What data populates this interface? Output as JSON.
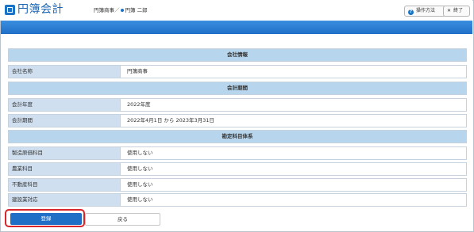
{
  "app": {
    "title": "円簿会計",
    "company": "円簿商事",
    "separator": "／",
    "user": "円簿 二郎"
  },
  "header_buttons": {
    "help_label": "操作方法",
    "exit_label": "終了"
  },
  "sections": {
    "company_info": {
      "title": "会社情報",
      "rows": [
        {
          "label": "会社名称",
          "value": "円簿商事"
        }
      ]
    },
    "period": {
      "title": "会計期間",
      "rows": [
        {
          "label": "会計年度",
          "value": "2022年度"
        },
        {
          "label": "会計期間",
          "value": "2022年4月1日 から 2023年3月31日"
        }
      ]
    },
    "accounts": {
      "title": "勘定科目体系",
      "rows": [
        {
          "label": "製造原価科目",
          "value": "使用しない"
        },
        {
          "label": "農業科目",
          "value": "使用しない"
        },
        {
          "label": "不動産科目",
          "value": "使用しない"
        },
        {
          "label": "建設業対応",
          "value": "使用しない"
        }
      ]
    }
  },
  "footer": {
    "register_label": "登録",
    "back_label": "戻る"
  },
  "colors": {
    "brand": "#1a66b4",
    "bar": "#1f6fc7",
    "section_bg": "#b7d6ee",
    "label_bg": "#cfdff0",
    "highlight": "#d8262c"
  }
}
